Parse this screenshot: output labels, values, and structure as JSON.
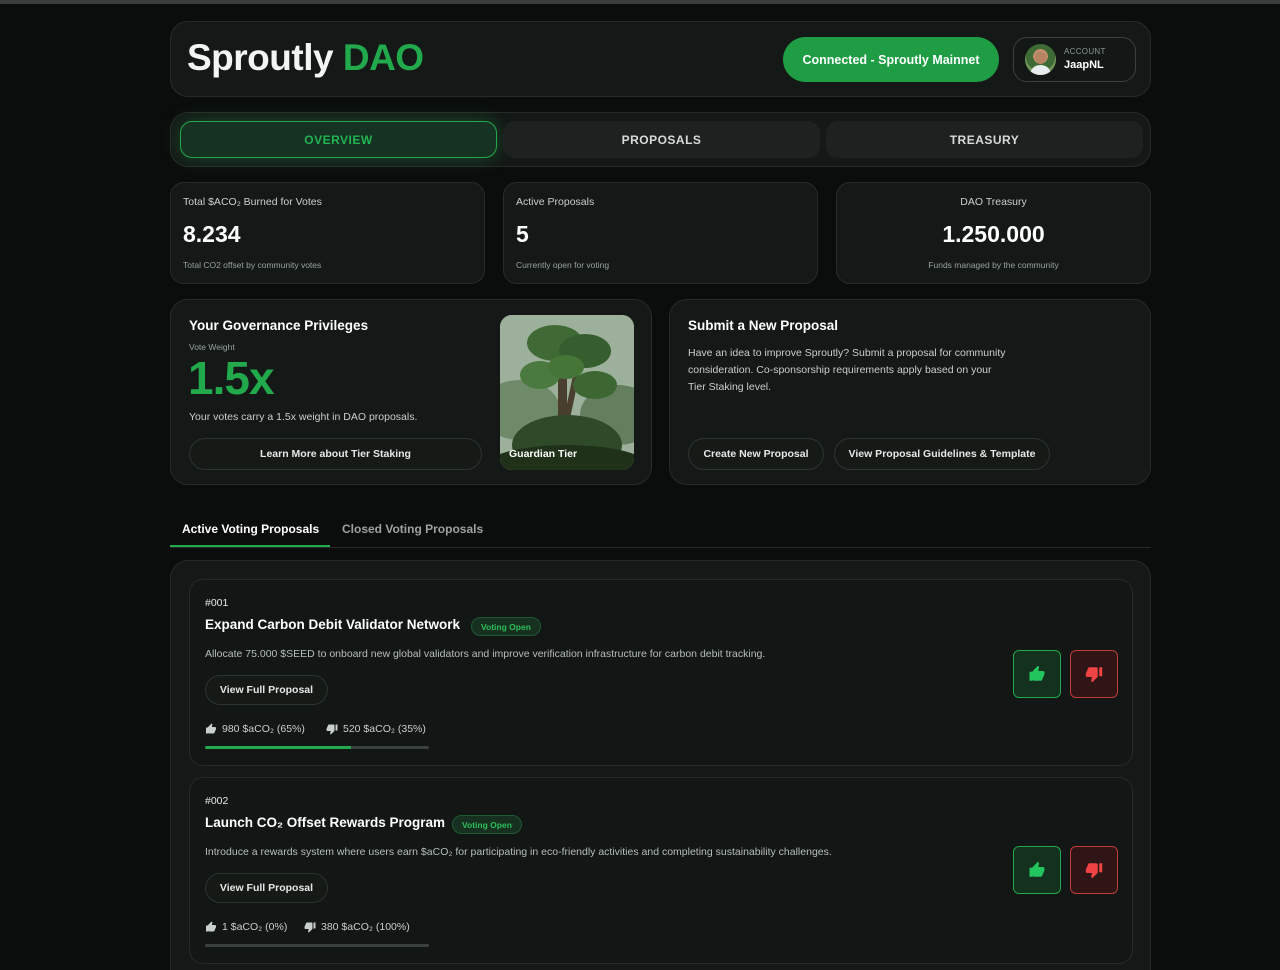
{
  "header": {
    "brand_main": "Sproutly",
    "brand_accent": "DAO",
    "connect_label": "Connected - Sproutly Mainnet",
    "account_label": "ACCOUNT",
    "account_name": "JaapNL"
  },
  "tabs": [
    {
      "label": "OVERVIEW",
      "active": true
    },
    {
      "label": "PROPOSALS",
      "active": false
    },
    {
      "label": "TREASURY",
      "active": false
    }
  ],
  "stats": [
    {
      "label": "Total $ACO₂ Burned for Votes",
      "value": "8.234",
      "sub": "Total CO2 offset by community votes"
    },
    {
      "label": "Active Proposals",
      "value": "5",
      "sub": "Currently open for voting"
    },
    {
      "label": "DAO Treasury",
      "value": "1.250.000",
      "sub": "Funds managed by the community"
    }
  ],
  "governance": {
    "title": "Your Governance Privileges",
    "weight_label": "Vote Weight",
    "weight": "1.5x",
    "description": "Your votes carry a 1.5x weight in DAO proposals.",
    "button": "Learn More about Tier Staking",
    "tier_label": "Guardian Tier"
  },
  "submit": {
    "title": "Submit a New Proposal",
    "description": "Have an idea to improve Sproutly? Submit a proposal for community consideration. Co-sponsorship requirements apply based on your Tier Staking level.",
    "create_button": "Create New Proposal",
    "guidelines_button": "View Proposal Guidelines & Template"
  },
  "proposal_tabs": {
    "active": "Active Voting Proposals",
    "closed": "Closed Voting Proposals"
  },
  "proposals": [
    {
      "number": "#001",
      "title": "Expand Carbon Debit Validator Network",
      "status": "Voting Open",
      "description": "Allocate 75.000 $SEED to onboard new global validators and improve verification infrastructure for carbon debit tracking.",
      "view_label": "View Full Proposal",
      "yes_tally": "980 $aCO₂ (65%)",
      "no_tally": "520 $aCO₂ (35%)",
      "yes_fraction": 0.65
    },
    {
      "number": "#002",
      "title": "Launch CO₂ Offset Rewards Program",
      "status": "Voting Open",
      "description": "Introduce a rewards system where users earn $aCO₂ for participating in eco-friendly activities and completing sustainability challenges.",
      "view_label": "View Full Proposal",
      "yes_tally": "1 $aCO₂ (0%)",
      "no_tally": "380 $aCO₂ (100%)",
      "yes_fraction": 0.0
    }
  ],
  "colors": {
    "accent": "#22a94c",
    "danger": "#c43b3b",
    "background": "#0b0d0c"
  },
  "icons": {
    "vote_up": "thumbs-up-icon",
    "vote_down": "thumbs-down-icon"
  }
}
